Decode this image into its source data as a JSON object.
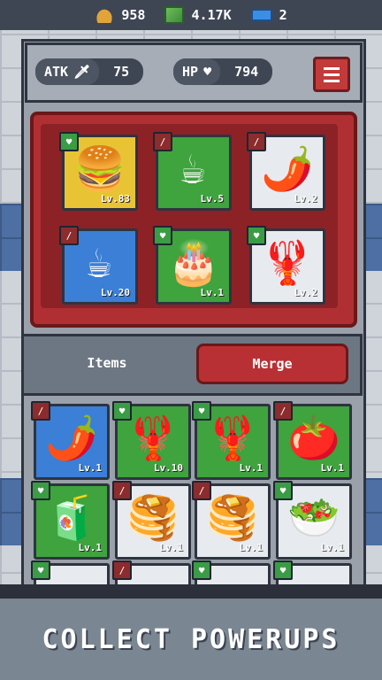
{
  "resources": [
    {
      "icon": "gold-pile-icon",
      "value": "958"
    },
    {
      "icon": "cash-stack-icon",
      "value": "4.17K"
    },
    {
      "icon": "gem-icon",
      "value": "2"
    }
  ],
  "stats": {
    "atk_label": "ATK",
    "atk_value": "75",
    "hp_label": "HP",
    "hp_value": "794"
  },
  "equipped": [
    {
      "name": "burger",
      "emoji": "🍔",
      "level": "Lv.83",
      "bg": "yellow",
      "badge": "heart"
    },
    {
      "name": "coffee",
      "emoji": "☕",
      "level": "Lv.5",
      "bg": "green",
      "badge": "sword"
    },
    {
      "name": "chili",
      "emoji": "🌶️",
      "level": "Lv.2",
      "bg": "white",
      "badge": "sword"
    },
    {
      "name": "coffee",
      "emoji": "☕",
      "level": "Lv.20",
      "bg": "blue",
      "badge": "sword"
    },
    {
      "name": "cake",
      "emoji": "🎂",
      "level": "Lv.1",
      "bg": "green",
      "badge": "heart"
    },
    {
      "name": "lobster",
      "emoji": "🦞",
      "level": "Lv.2",
      "bg": "white",
      "badge": "heart"
    }
  ],
  "tabs": {
    "items_label": "Items",
    "merge_label": "Merge"
  },
  "inventory": [
    {
      "name": "chili",
      "emoji": "🌶️",
      "level": "Lv.1",
      "bg": "blue",
      "badge": "sword"
    },
    {
      "name": "lobster",
      "emoji": "🦞",
      "level": "Lv.10",
      "bg": "green",
      "badge": "heart"
    },
    {
      "name": "lobster",
      "emoji": "🦞",
      "level": "Lv.1",
      "bg": "green",
      "badge": "heart"
    },
    {
      "name": "tomato",
      "emoji": "🍅",
      "level": "Lv.1",
      "bg": "green",
      "badge": "sword"
    },
    {
      "name": "juice-box",
      "emoji": "🧃",
      "level": "Lv.1",
      "bg": "green",
      "badge": "heart"
    },
    {
      "name": "pancakes",
      "emoji": "🥞",
      "level": "Lv.1",
      "bg": "white",
      "badge": "sword"
    },
    {
      "name": "pancakes",
      "emoji": "🥞",
      "level": "Lv.1",
      "bg": "white",
      "badge": "sword"
    },
    {
      "name": "salad",
      "emoji": "🥗",
      "level": "Lv.1",
      "bg": "white",
      "badge": "heart"
    },
    {
      "name": "partial",
      "emoji": "",
      "level": "",
      "bg": "white",
      "badge": "heart"
    },
    {
      "name": "partial",
      "emoji": "",
      "level": "",
      "bg": "white",
      "badge": "sword"
    },
    {
      "name": "partial",
      "emoji": "",
      "level": "",
      "bg": "white",
      "badge": "heart"
    },
    {
      "name": "partial",
      "emoji": "",
      "level": "",
      "bg": "white",
      "badge": "heart"
    }
  ],
  "headline": "COLLECT POWERUPS",
  "colors": {
    "accent_red": "#b02f33",
    "heart_green": "#3a9c45",
    "sword_red": "#8c2c2c"
  }
}
